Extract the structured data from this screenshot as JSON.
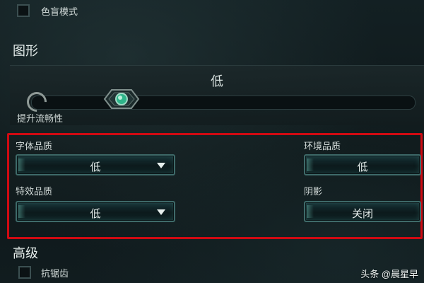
{
  "display": {
    "colorblind_label": "色盲模式",
    "colorblind_checked": false
  },
  "graphics": {
    "section_title": "图形",
    "quality_slider": {
      "value_label": "低",
      "hint": "提升流畅性",
      "level": 0.15
    },
    "font_quality": {
      "label": "字体品质",
      "value": "低"
    },
    "environment_quality": {
      "label": "环境品质",
      "value": "低"
    },
    "effects_quality": {
      "label": "特效品质",
      "value": "低"
    },
    "shadows": {
      "label": "阴影",
      "value": "关闭"
    }
  },
  "advanced": {
    "section_title": "高级",
    "antialiasing_label": "抗锯齿",
    "antialiasing_checked": false
  },
  "watermark": {
    "text": "头条 @晨星早"
  },
  "colors": {
    "highlight": "#d00a12",
    "accent_teal": "#3e6a69",
    "thumb_green": "#2fb58a"
  }
}
